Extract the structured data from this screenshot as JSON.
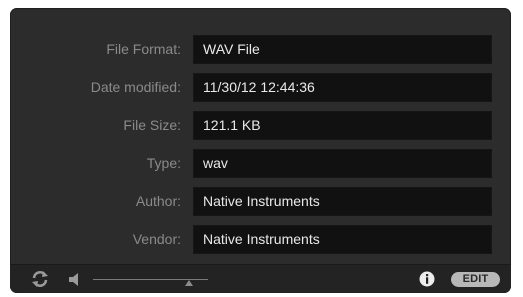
{
  "properties": [
    {
      "label": "File Format:",
      "value": "WAV File"
    },
    {
      "label": "Date modified:",
      "value": "11/30/12 12:44:36"
    },
    {
      "label": "File Size:",
      "value": "121.1 KB"
    },
    {
      "label": "Type:",
      "value": "wav"
    },
    {
      "label": "Author:",
      "value": "Native Instruments"
    },
    {
      "label": "Vendor:",
      "value": "Native Instruments"
    }
  ],
  "footer": {
    "edit_label": "EDIT",
    "icons": [
      "loop-icon",
      "speaker-icon",
      "info-icon"
    ]
  },
  "colors": {
    "panel_background": "#2c2c2c",
    "field_background": "#111111",
    "label_text": "#8a8a8a",
    "value_text": "#e9e9e9"
  }
}
